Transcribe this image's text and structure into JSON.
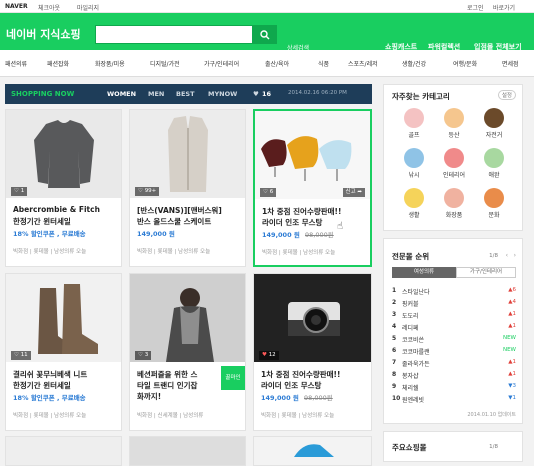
{
  "topbar": {
    "naver": "NAVER",
    "link1": "체크아웃",
    "link2": "마일리지",
    "login": "로그인",
    "more": "바로가기"
  },
  "header": {
    "brand": "네이버 지식쇼핑",
    "search_value": "",
    "detail_search": "상세검색",
    "link1": "쇼핑캐스트",
    "link2": "파워컬렉션",
    "link3": "입점몰 전체보기"
  },
  "categories": [
    "패션의류",
    "패션잡화",
    "화장품/미용",
    "디지털/가전",
    "가구/인테리어",
    "출산/육아",
    "식품",
    "스포츠/레저",
    "생활/건강",
    "여행/문화",
    "면세점"
  ],
  "subnav": {
    "logo": "SHOPPING NOW",
    "tabs": [
      "WOMEN",
      "MEN",
      "BEST",
      "MYNOW"
    ],
    "likes": "16",
    "date": "2014.02.16 06:20 PM"
  },
  "products": [
    {
      "badge": "1",
      "t1": "Abercrombie & Fitch",
      "t2": "한정기간 윈터세일",
      "price": "18% 할인쿠폰 , 무료배송",
      "old": "",
      "foot": "빅화점 | 롯데몰 | 남성의류  오늘"
    },
    {
      "badge": "99+",
      "t1": "[반스(VANS)][맨버스워]",
      "t2": "반스 올드스쿨 스케이트",
      "price": "149,000 원",
      "old": "",
      "foot": "빅화점 | 롯데몰 | 남성의류  오늘"
    },
    {
      "badge": "6",
      "t1": "1차 중점 진어수량판매!!",
      "t2": "라이더 인조 무스탕",
      "price": "149,000 원",
      "old": "98,000원",
      "foot": "빅화점 | 롯데몰 | 남성의류  오늘",
      "badge2": "신고"
    },
    {
      "badge": "11",
      "t1": "결리쉬 꽃무늬베색 니트",
      "t2": "한정기간 윈터세일",
      "price": "18% 할인쿠폰 , 무료배송",
      "old": "",
      "foot": "빅화점 | 롯데몰 | 남성의류  오늘"
    },
    {
      "badge": "3",
      "t1": "베션퍼즐을 위한 스",
      "t2": "타일 트랜디 인기잡",
      "t3": "화까지!",
      "price": "",
      "old": "",
      "foot": "빅화점 | 신세계몰 | 남성의류",
      "tag": "꿀마인"
    },
    {
      "badge": "12",
      "t1": "1차 중점 진어수량판매!!",
      "t2": "라이더 인조 무스탕",
      "price": "149,000 원",
      "old": "98,000원",
      "foot": "빅화점 | 롯데몰 | 남성의류  오늘"
    }
  ],
  "favorites": {
    "title": "자주찾는 카테고리",
    "setting": "설정",
    "items": [
      "골프",
      "등산",
      "자전거",
      "낚시",
      "인테리어",
      "애완",
      "생활",
      "화장품",
      "문화"
    ]
  },
  "ranking": {
    "title": "전문몰 순위",
    "page": "1/8",
    "tab_on": "여성의류",
    "tab_off": "가구/인테리어",
    "items": [
      {
        "n": "1",
        "name": "스타일난다",
        "change": "▲6"
      },
      {
        "n": "2",
        "name": "핑커블",
        "change": "▲4"
      },
      {
        "n": "3",
        "name": "도도리",
        "change": "▲1"
      },
      {
        "n": "4",
        "name": "레디페",
        "change": "▲1"
      },
      {
        "n": "5",
        "name": "코코비쓴",
        "change": "NEW"
      },
      {
        "n": "6",
        "name": "코코마를랜",
        "change": "NEW"
      },
      {
        "n": "7",
        "name": "줄라욱가든",
        "change": "▲1"
      },
      {
        "n": "8",
        "name": "봉자샵",
        "change": "▲1"
      },
      {
        "n": "9",
        "name": "체리쉘",
        "change": "▼3"
      },
      {
        "n": "10",
        "name": "원엔레빗",
        "change": "▼1"
      }
    ],
    "update": "2014.01.10 업데이트"
  },
  "bottom": {
    "title": "주요쇼핑몰",
    "page": "1/8"
  }
}
